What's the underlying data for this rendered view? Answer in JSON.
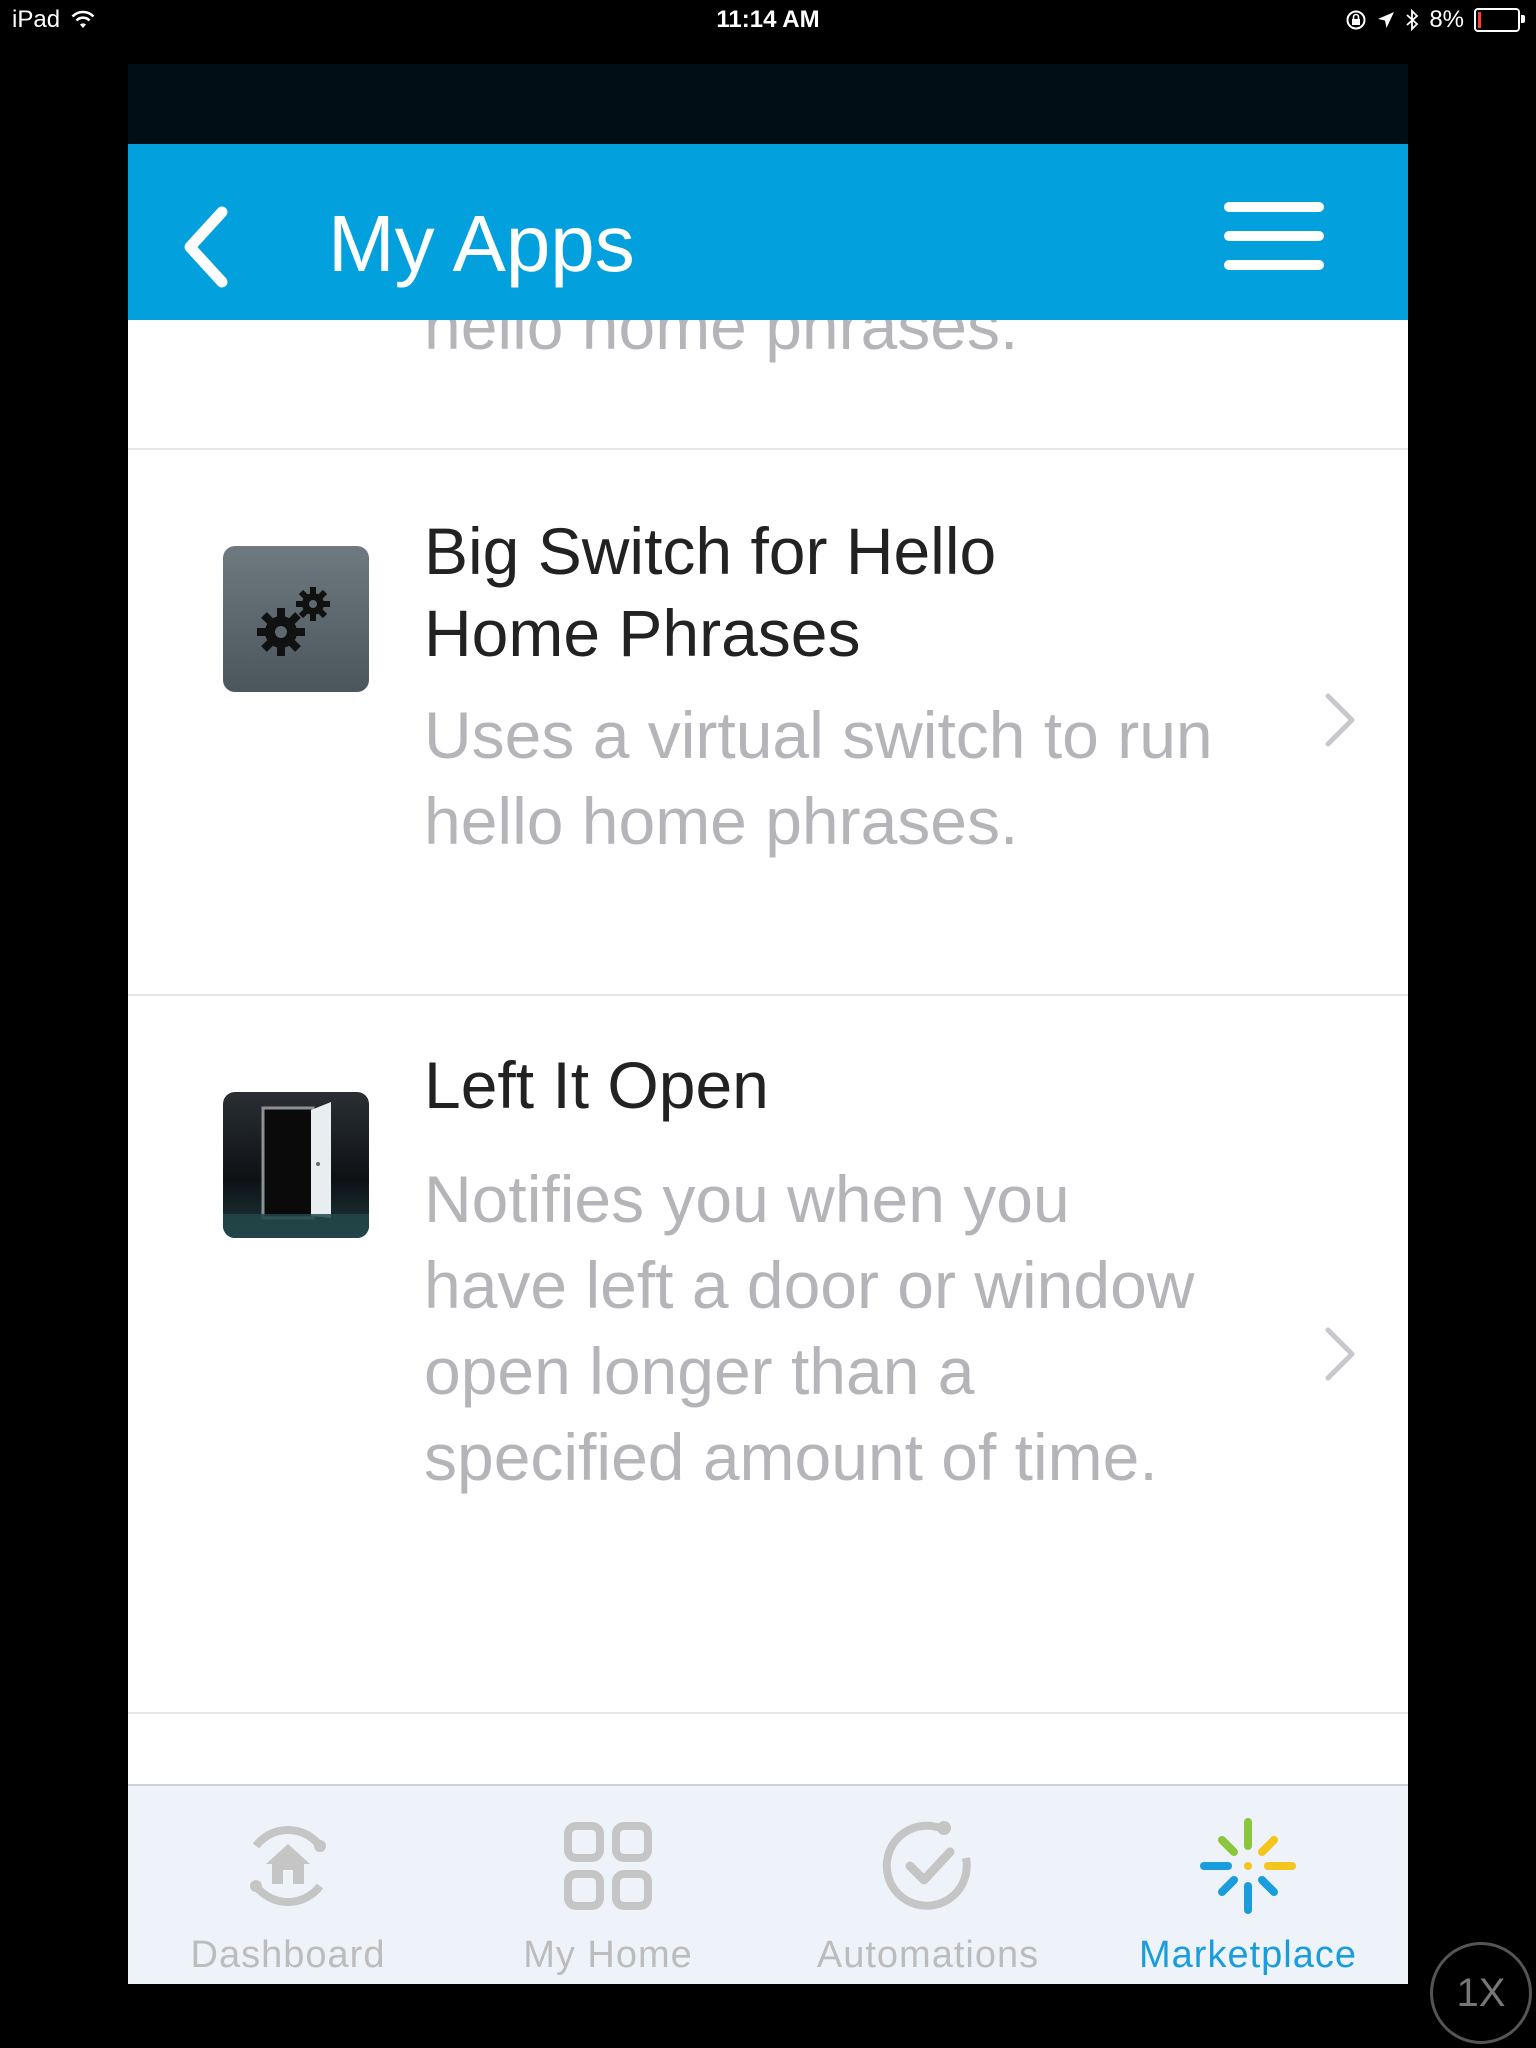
{
  "status_bar": {
    "device": "iPad",
    "time": "11:14 AM",
    "battery": "8%",
    "battery_level": 0.08
  },
  "header": {
    "title": "My Apps"
  },
  "list": {
    "partial_text": "hello home phrases.",
    "items": [
      {
        "title": "Big Switch for Hello Home Phrases",
        "description": "Uses a virtual switch to run hello home phrases.",
        "icon": "gears-icon"
      },
      {
        "title": "Left It Open",
        "description": "Notifies you when you have left a door or window open longer than a specified amount of time.",
        "icon": "open-door-icon"
      }
    ]
  },
  "tabs": [
    {
      "label": "Dashboard",
      "icon": "dashboard-icon",
      "active": false
    },
    {
      "label": "My Home",
      "icon": "grid-icon",
      "active": false
    },
    {
      "label": "Automations",
      "icon": "automations-icon",
      "active": false
    },
    {
      "label": "Marketplace",
      "icon": "marketplace-icon",
      "active": true
    }
  ],
  "colors": {
    "header": "#02a0dd",
    "active_tab": "#1a9ddc",
    "inactive_tab": "#bcbcbc"
  },
  "zoom_badge": "1X"
}
